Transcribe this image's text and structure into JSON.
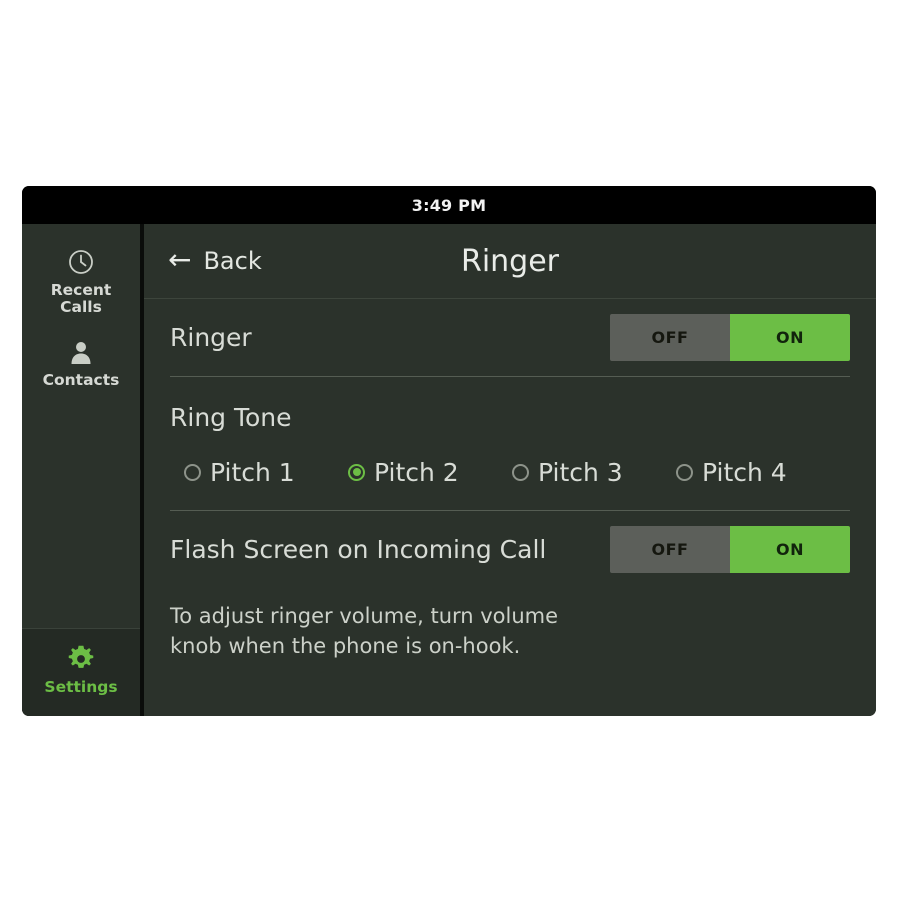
{
  "status_bar": {
    "time": "3:49 PM"
  },
  "sidebar": {
    "items": [
      {
        "id": "recent-calls",
        "icon": "clock-icon",
        "label": "Recent\nCalls",
        "label_line1": "Recent",
        "label_line2": "Calls",
        "active": false
      },
      {
        "id": "contacts",
        "icon": "person-icon",
        "label": "Contacts",
        "active": false
      },
      {
        "id": "settings",
        "icon": "gear-icon",
        "label": "Settings",
        "active": true
      }
    ]
  },
  "header": {
    "back_label": "Back",
    "back_icon": "arrow-left-icon",
    "title": "Ringer"
  },
  "settings": {
    "ringer": {
      "label": "Ringer",
      "toggle": {
        "off_label": "OFF",
        "on_label": "ON",
        "value": "ON"
      }
    },
    "ring_tone": {
      "title": "Ring Tone",
      "selected": "Pitch 2",
      "options": [
        {
          "label": "Pitch 1",
          "selected": false
        },
        {
          "label": "Pitch 2",
          "selected": true
        },
        {
          "label": "Pitch 3",
          "selected": false
        },
        {
          "label": "Pitch 4",
          "selected": false
        }
      ]
    },
    "flash_screen": {
      "label": "Flash Screen on Incoming Call",
      "toggle": {
        "off_label": "OFF",
        "on_label": "ON",
        "value": "ON"
      }
    },
    "help_text": "To adjust ringer volume, turn volume knob when the phone is on-hook."
  },
  "colors": {
    "accent_green": "#6CBE45",
    "panel_background": "#2b322b",
    "status_bar_background": "#000000",
    "toggle_off_background": "#5c5f5a",
    "text_primary": "#d8dcd6"
  }
}
